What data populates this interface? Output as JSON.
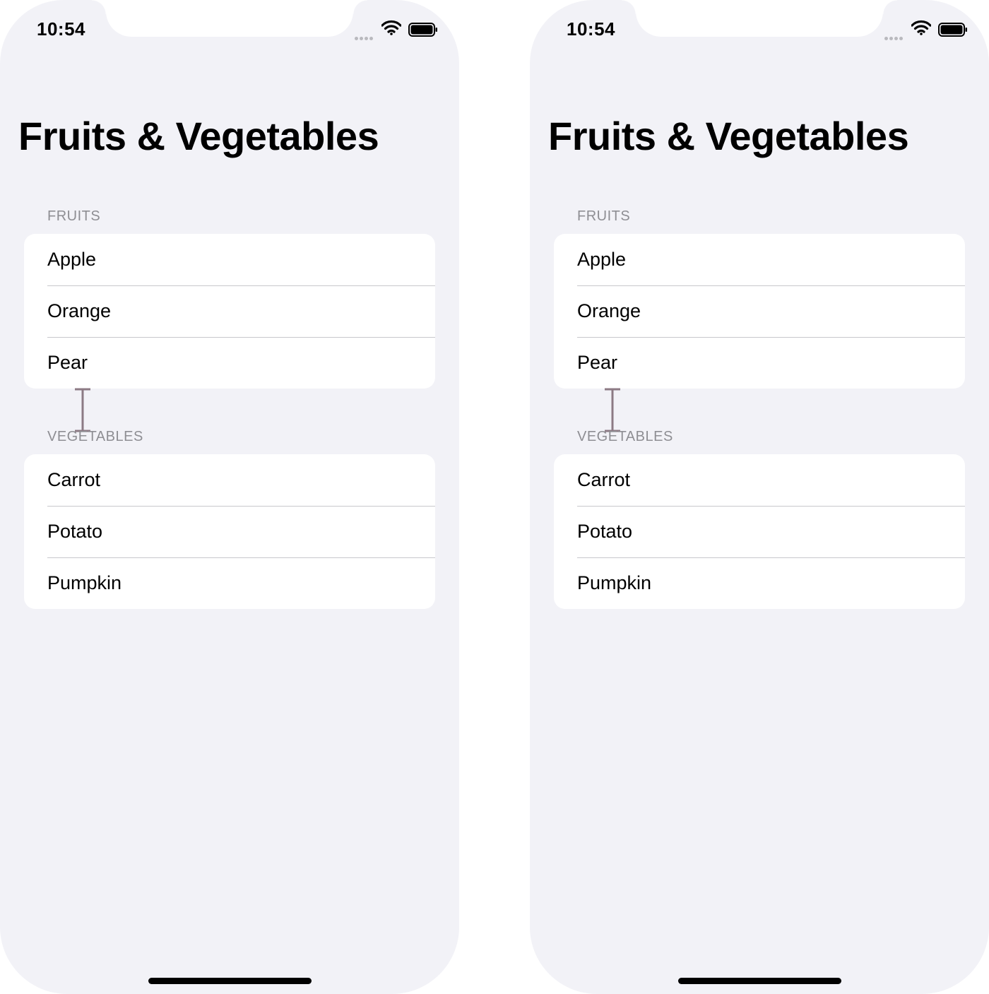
{
  "status_bar": {
    "time": "10:54"
  },
  "screen": {
    "title": "Fruits & Vegetables",
    "sections": [
      {
        "header": "FRUITS",
        "items": [
          "Apple",
          "Orange",
          "Pear"
        ]
      },
      {
        "header": "VEGETABLES",
        "items": [
          "Carrot",
          "Potato",
          "Pumpkin"
        ]
      }
    ]
  },
  "icons": [
    "signal-dots-icon",
    "wifi-icon",
    "battery-icon",
    "spacing-marker-icon",
    "home-indicator"
  ],
  "colors": {
    "background": "#f2f2f7",
    "card": "#ffffff",
    "header_text": "#8e8e93",
    "separator": "#c8c8cc",
    "marker": "#8c7a84"
  }
}
